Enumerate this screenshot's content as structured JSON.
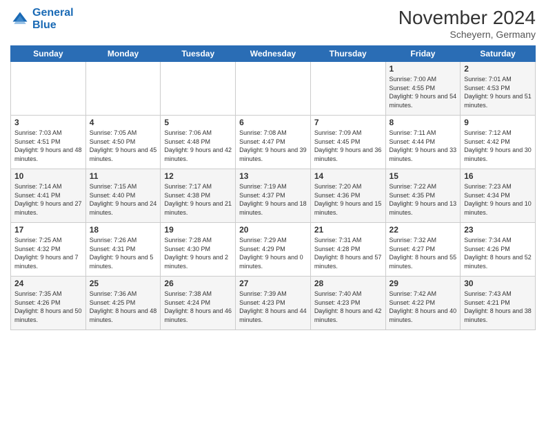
{
  "logo": {
    "line1": "General",
    "line2": "Blue"
  },
  "title": "November 2024",
  "subtitle": "Scheyern, Germany",
  "days_of_week": [
    "Sunday",
    "Monday",
    "Tuesday",
    "Wednesday",
    "Thursday",
    "Friday",
    "Saturday"
  ],
  "weeks": [
    [
      {
        "day": "",
        "info": ""
      },
      {
        "day": "",
        "info": ""
      },
      {
        "day": "",
        "info": ""
      },
      {
        "day": "",
        "info": ""
      },
      {
        "day": "",
        "info": ""
      },
      {
        "day": "1",
        "info": "Sunrise: 7:00 AM\nSunset: 4:55 PM\nDaylight: 9 hours and 54 minutes."
      },
      {
        "day": "2",
        "info": "Sunrise: 7:01 AM\nSunset: 4:53 PM\nDaylight: 9 hours and 51 minutes."
      }
    ],
    [
      {
        "day": "3",
        "info": "Sunrise: 7:03 AM\nSunset: 4:51 PM\nDaylight: 9 hours and 48 minutes."
      },
      {
        "day": "4",
        "info": "Sunrise: 7:05 AM\nSunset: 4:50 PM\nDaylight: 9 hours and 45 minutes."
      },
      {
        "day": "5",
        "info": "Sunrise: 7:06 AM\nSunset: 4:48 PM\nDaylight: 9 hours and 42 minutes."
      },
      {
        "day": "6",
        "info": "Sunrise: 7:08 AM\nSunset: 4:47 PM\nDaylight: 9 hours and 39 minutes."
      },
      {
        "day": "7",
        "info": "Sunrise: 7:09 AM\nSunset: 4:45 PM\nDaylight: 9 hours and 36 minutes."
      },
      {
        "day": "8",
        "info": "Sunrise: 7:11 AM\nSunset: 4:44 PM\nDaylight: 9 hours and 33 minutes."
      },
      {
        "day": "9",
        "info": "Sunrise: 7:12 AM\nSunset: 4:42 PM\nDaylight: 9 hours and 30 minutes."
      }
    ],
    [
      {
        "day": "10",
        "info": "Sunrise: 7:14 AM\nSunset: 4:41 PM\nDaylight: 9 hours and 27 minutes."
      },
      {
        "day": "11",
        "info": "Sunrise: 7:15 AM\nSunset: 4:40 PM\nDaylight: 9 hours and 24 minutes."
      },
      {
        "day": "12",
        "info": "Sunrise: 7:17 AM\nSunset: 4:38 PM\nDaylight: 9 hours and 21 minutes."
      },
      {
        "day": "13",
        "info": "Sunrise: 7:19 AM\nSunset: 4:37 PM\nDaylight: 9 hours and 18 minutes."
      },
      {
        "day": "14",
        "info": "Sunrise: 7:20 AM\nSunset: 4:36 PM\nDaylight: 9 hours and 15 minutes."
      },
      {
        "day": "15",
        "info": "Sunrise: 7:22 AM\nSunset: 4:35 PM\nDaylight: 9 hours and 13 minutes."
      },
      {
        "day": "16",
        "info": "Sunrise: 7:23 AM\nSunset: 4:34 PM\nDaylight: 9 hours and 10 minutes."
      }
    ],
    [
      {
        "day": "17",
        "info": "Sunrise: 7:25 AM\nSunset: 4:32 PM\nDaylight: 9 hours and 7 minutes."
      },
      {
        "day": "18",
        "info": "Sunrise: 7:26 AM\nSunset: 4:31 PM\nDaylight: 9 hours and 5 minutes."
      },
      {
        "day": "19",
        "info": "Sunrise: 7:28 AM\nSunset: 4:30 PM\nDaylight: 9 hours and 2 minutes."
      },
      {
        "day": "20",
        "info": "Sunrise: 7:29 AM\nSunset: 4:29 PM\nDaylight: 9 hours and 0 minutes."
      },
      {
        "day": "21",
        "info": "Sunrise: 7:31 AM\nSunset: 4:28 PM\nDaylight: 8 hours and 57 minutes."
      },
      {
        "day": "22",
        "info": "Sunrise: 7:32 AM\nSunset: 4:27 PM\nDaylight: 8 hours and 55 minutes."
      },
      {
        "day": "23",
        "info": "Sunrise: 7:34 AM\nSunset: 4:26 PM\nDaylight: 8 hours and 52 minutes."
      }
    ],
    [
      {
        "day": "24",
        "info": "Sunrise: 7:35 AM\nSunset: 4:26 PM\nDaylight: 8 hours and 50 minutes."
      },
      {
        "day": "25",
        "info": "Sunrise: 7:36 AM\nSunset: 4:25 PM\nDaylight: 8 hours and 48 minutes."
      },
      {
        "day": "26",
        "info": "Sunrise: 7:38 AM\nSunset: 4:24 PM\nDaylight: 8 hours and 46 minutes."
      },
      {
        "day": "27",
        "info": "Sunrise: 7:39 AM\nSunset: 4:23 PM\nDaylight: 8 hours and 44 minutes."
      },
      {
        "day": "28",
        "info": "Sunrise: 7:40 AM\nSunset: 4:23 PM\nDaylight: 8 hours and 42 minutes."
      },
      {
        "day": "29",
        "info": "Sunrise: 7:42 AM\nSunset: 4:22 PM\nDaylight: 8 hours and 40 minutes."
      },
      {
        "day": "30",
        "info": "Sunrise: 7:43 AM\nSunset: 4:21 PM\nDaylight: 8 hours and 38 minutes."
      }
    ]
  ]
}
